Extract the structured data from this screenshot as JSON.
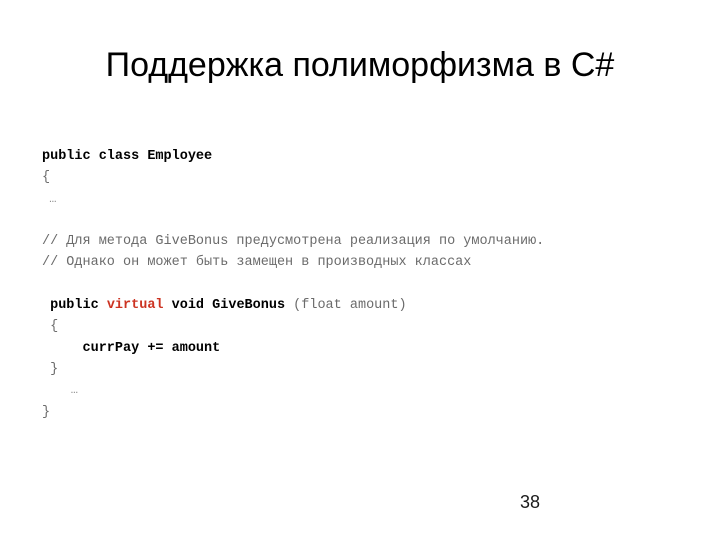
{
  "slide": {
    "title": "Поддержка полиморфизма в C#",
    "page_number": "38",
    "background_color": "#ffffff"
  },
  "colors": {
    "title_text": "#000000",
    "code_text": "#000000",
    "code_dim": "#6b6b6b",
    "keyword_virtual": "#cc3322",
    "page_number_text": "#1a1a1a"
  },
  "code": {
    "language": "csharp",
    "lines": [
      {
        "id": "line-class-decl",
        "tokens": [
          {
            "text": "public class Employee",
            "style": "bold"
          }
        ]
      },
      {
        "id": "line-class-open-brace",
        "tokens": [
          {
            "text": "{",
            "style": "dim"
          }
        ]
      },
      {
        "id": "line-class-ellipsis",
        "tokens": [
          {
            "text": " …",
            "style": "ellipsis"
          }
        ]
      },
      {
        "id": "line-blank-1",
        "tokens": [
          {
            "text": " ",
            "style": "dim"
          }
        ]
      },
      {
        "id": "line-comment-1",
        "tokens": [
          {
            "text": "// Для метода GiveBonus предусмотрена реализация по умолчанию.",
            "style": "dim"
          }
        ]
      },
      {
        "id": "line-comment-2",
        "tokens": [
          {
            "text": "// Однако он может быть замещен в производных классах",
            "style": "dim"
          }
        ]
      },
      {
        "id": "line-blank-2",
        "tokens": [
          {
            "text": " ",
            "style": "dim"
          }
        ]
      },
      {
        "id": "line-method-signature",
        "tokens": [
          {
            "text": " public ",
            "style": "bold"
          },
          {
            "text": "virtual",
            "style": "keyword"
          },
          {
            "text": " void GiveBonus ",
            "style": "bold"
          },
          {
            "text": "(float amount)",
            "style": "dim"
          }
        ]
      },
      {
        "id": "line-method-open-brace",
        "tokens": [
          {
            "text": " {",
            "style": "dim"
          }
        ]
      },
      {
        "id": "line-body-assignment",
        "tokens": [
          {
            "text": "     currPay += amount",
            "style": "bold"
          }
        ]
      },
      {
        "id": "line-method-close-brace",
        "tokens": [
          {
            "text": " }",
            "style": "dim"
          }
        ]
      },
      {
        "id": "line-method-ellipsis",
        "tokens": [
          {
            "text": "    …",
            "style": "ellipsis"
          }
        ]
      },
      {
        "id": "line-class-close-brace",
        "tokens": [
          {
            "text": "}",
            "style": "dim"
          }
        ]
      }
    ]
  }
}
